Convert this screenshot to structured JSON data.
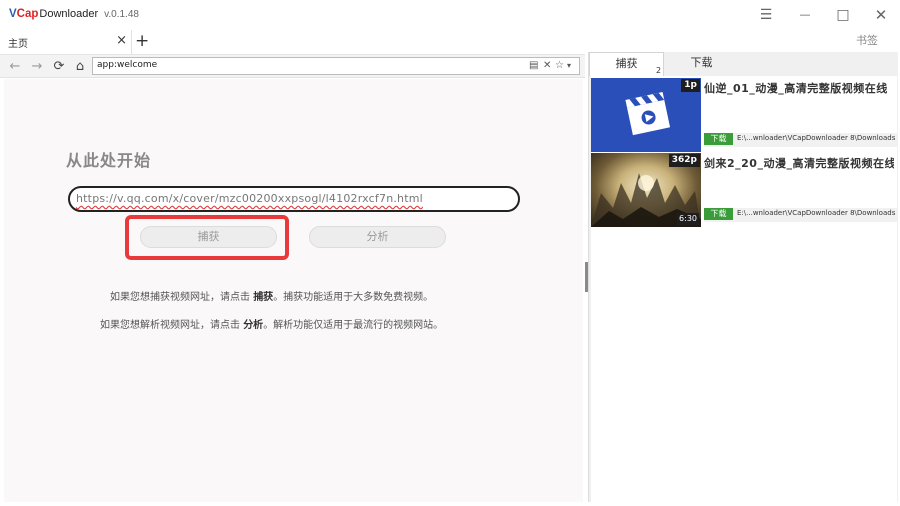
{
  "app": {
    "logo_v": "V",
    "logo_cap": "Cap",
    "logo_rest": "Downloader",
    "version": "v.0.1.48"
  },
  "window_controls": {
    "menu": "☰",
    "minimize": "—",
    "maximize": "□",
    "close": "✕"
  },
  "browser": {
    "tab_label": "主页",
    "tab_close": "×",
    "new_tab": "+",
    "bookmarks_label": "书签",
    "address": "app:welcome"
  },
  "welcome": {
    "heading": "从此处开始",
    "input_url": "https://v.qq.com/x/cover/mzc00200xxpsogl/l4102rxcf7n.html",
    "capture_button": "捕获",
    "analyze_button": "分析",
    "hint1_pre": "如果您想捕获视频网址，请点击 ",
    "hint1_bold": "捕获",
    "hint1_post": "。捕获功能适用于大多数免费视频。",
    "hint2_pre": "如果您想解析视频网址，请点击 ",
    "hint2_bold": "分析",
    "hint2_post": "。解析功能仅适用于最流行的视频网站。"
  },
  "panel": {
    "tab_capture": "捕获",
    "tab_capture_count": "2",
    "tab_download": "下载",
    "items": [
      {
        "title": "仙逆_01_动漫_高清完整版视频在线",
        "badge": "1p",
        "duration": "",
        "download_label": "下载",
        "path": "E:\\...wnloader\\VCapDownloader 8\\Downloads"
      },
      {
        "title": "剑来2_20_动漫_高清完整版视频在线",
        "badge": "362p",
        "duration": "6:30",
        "download_label": "下载",
        "path": "E:\\...wnloader\\VCapDownloader 8\\Downloads"
      }
    ]
  },
  "colors": {
    "highlight": "#e83a3a",
    "download_green": "#3a9d3a",
    "thumb1_bg": "#2b4fb8"
  }
}
